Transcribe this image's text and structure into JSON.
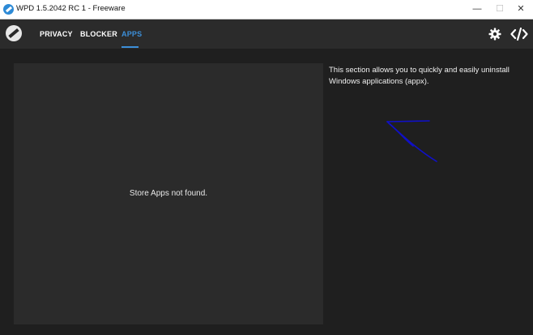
{
  "window": {
    "title": "WPD 1.5.2042 RC 1 - Freeware",
    "controls": {
      "minimize": "—",
      "maximize": "☐",
      "close": "✕"
    }
  },
  "nav": {
    "tabs": [
      {
        "label": "PRIVACY",
        "active": false
      },
      {
        "label": "BLOCKER",
        "active": false
      },
      {
        "label": "APPS",
        "active": true
      }
    ],
    "icons": [
      "app-logo-icon",
      "settings-gear-icon",
      "code-icon"
    ]
  },
  "apps": {
    "empty_message": "Store Apps not found."
  },
  "info": {
    "description": "This section allows you to quickly and easily uninstall Windows applications (appx)."
  },
  "colors": {
    "accent": "#3c8fd8",
    "background": "#1f1f1f",
    "panel": "#2b2b2b",
    "annotation_arrow": "#1010c8"
  }
}
